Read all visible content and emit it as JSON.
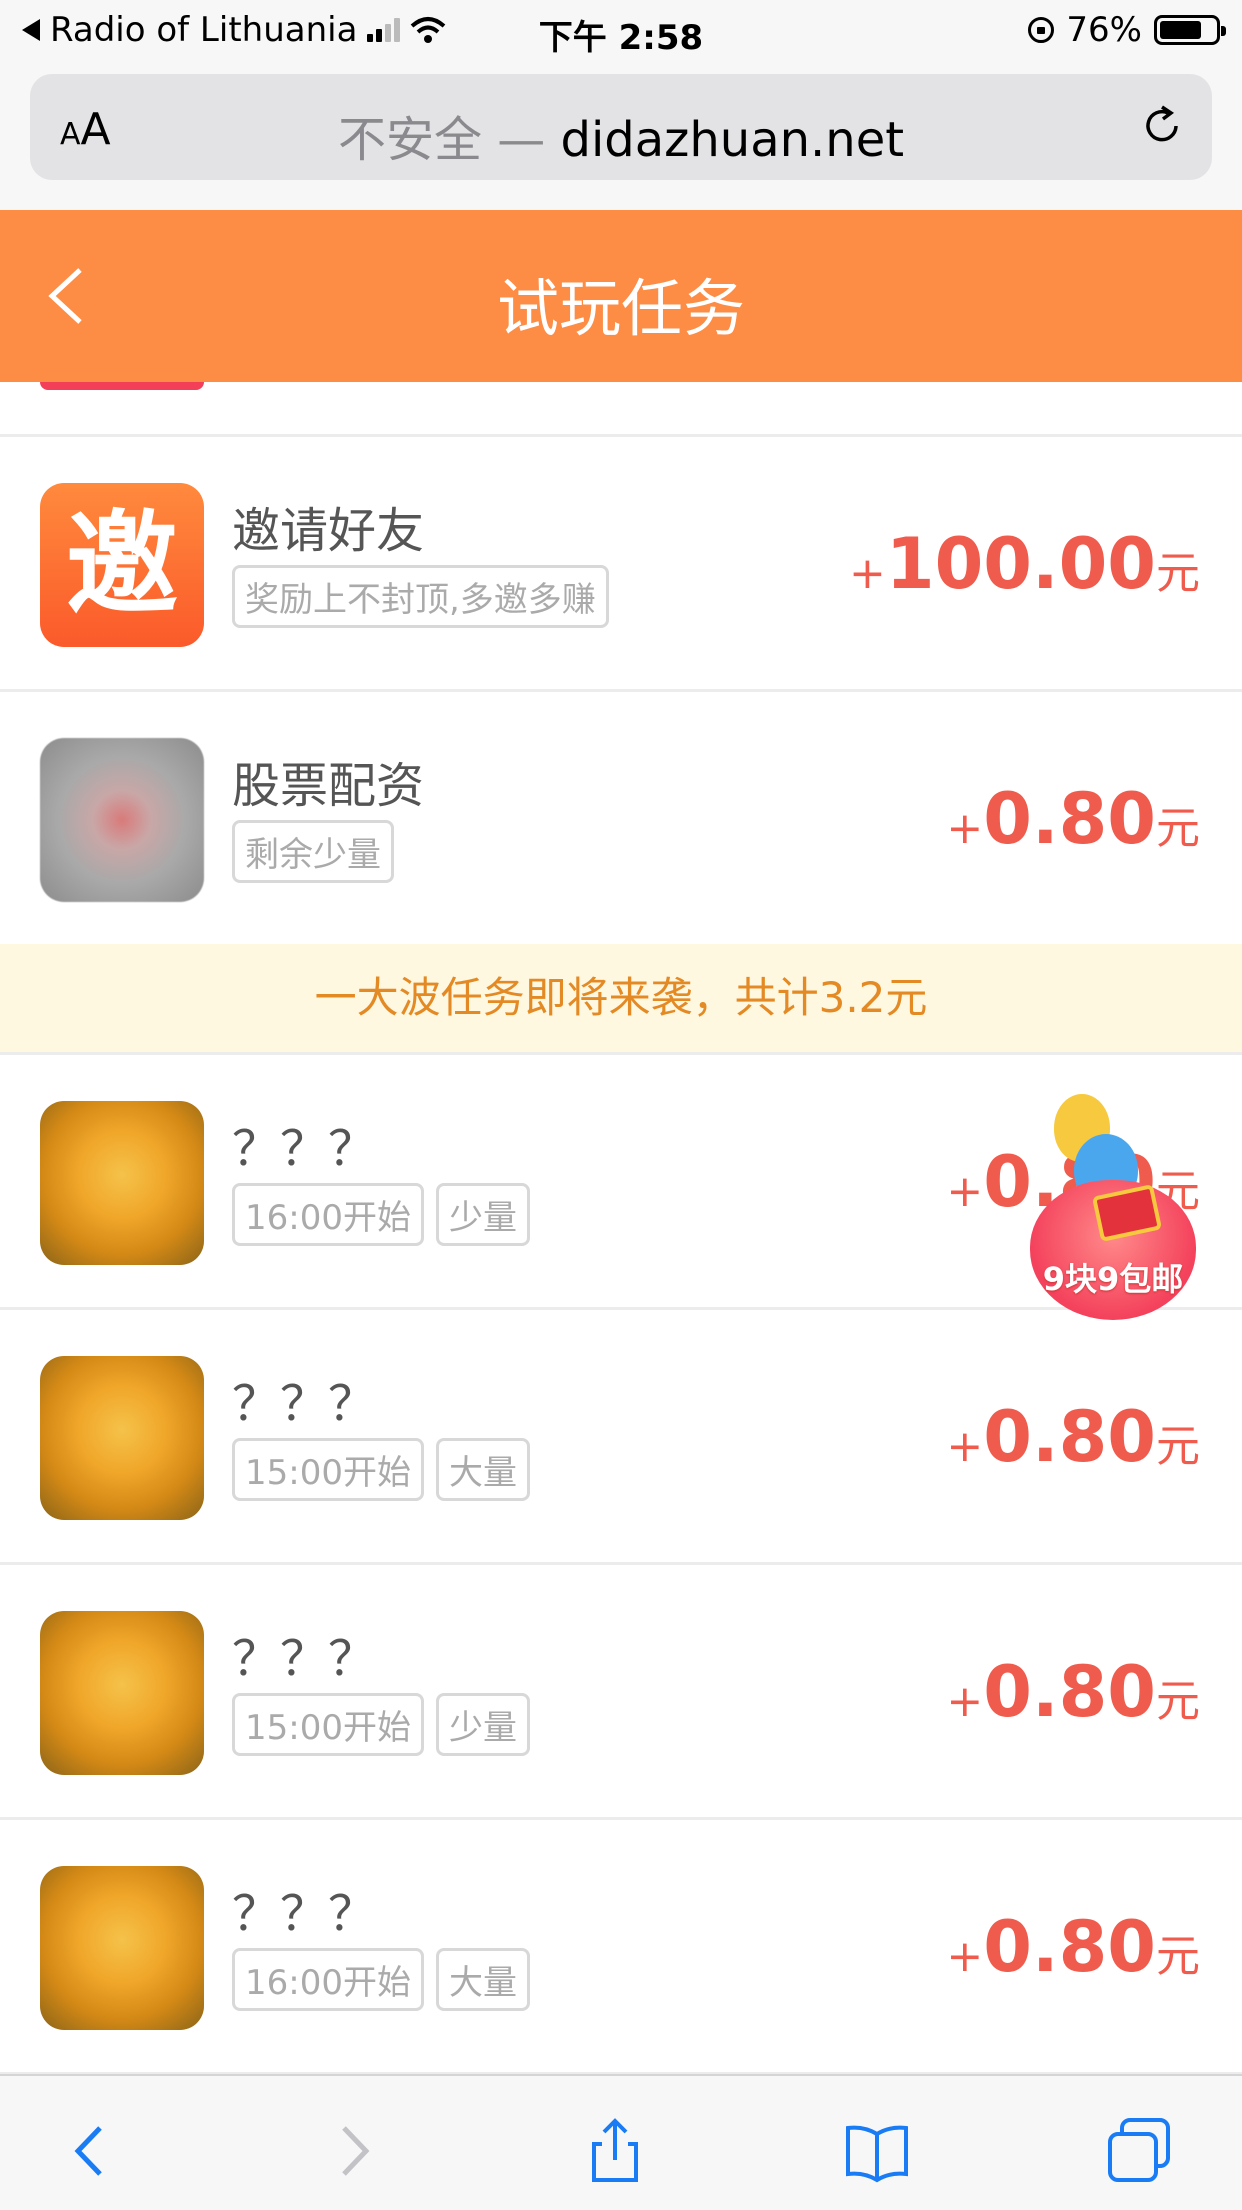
{
  "status_bar": {
    "carrier": "Radio of Lithuania",
    "time": "下午 2:58",
    "battery": "76%",
    "battery_level": 0.76
  },
  "browser": {
    "aa_label": "AA",
    "insecure_label": "不安全 —",
    "domain": "didazhuan.net"
  },
  "header": {
    "title": "试玩任务"
  },
  "tasks": [
    {
      "name": "邀请好友",
      "thumb_text": "邀",
      "tags": [
        "奖励上不封顶,多邀多赚"
      ],
      "plus": "+",
      "amount": "100.00",
      "unit": "元"
    },
    {
      "name": "股票配资",
      "tags": [
        "剩余少量"
      ],
      "plus": "+",
      "amount": "0.80",
      "unit": "元"
    }
  ],
  "banner": {
    "text": "一大波任务即将来袭，共计3.2元"
  },
  "upcoming": [
    {
      "name": "？？？",
      "tags": [
        "16:00开始",
        "少量"
      ],
      "plus": "+",
      "amount": "0.80",
      "unit": "元"
    },
    {
      "name": "？？？",
      "tags": [
        "15:00开始",
        "大量"
      ],
      "plus": "+",
      "amount": "0.80",
      "unit": "元"
    },
    {
      "name": "？？？",
      "tags": [
        "15:00开始",
        "少量"
      ],
      "plus": "+",
      "amount": "0.80",
      "unit": "元"
    },
    {
      "name": "？？？",
      "tags": [
        "16:00开始",
        "大量"
      ],
      "plus": "+",
      "amount": "0.80",
      "unit": "元"
    }
  ],
  "promo": {
    "label": "9块9包邮"
  },
  "toolbar": {
    "icons": [
      "back-icon",
      "forward-icon",
      "share-icon",
      "bookmarks-icon",
      "tabs-icon"
    ]
  }
}
